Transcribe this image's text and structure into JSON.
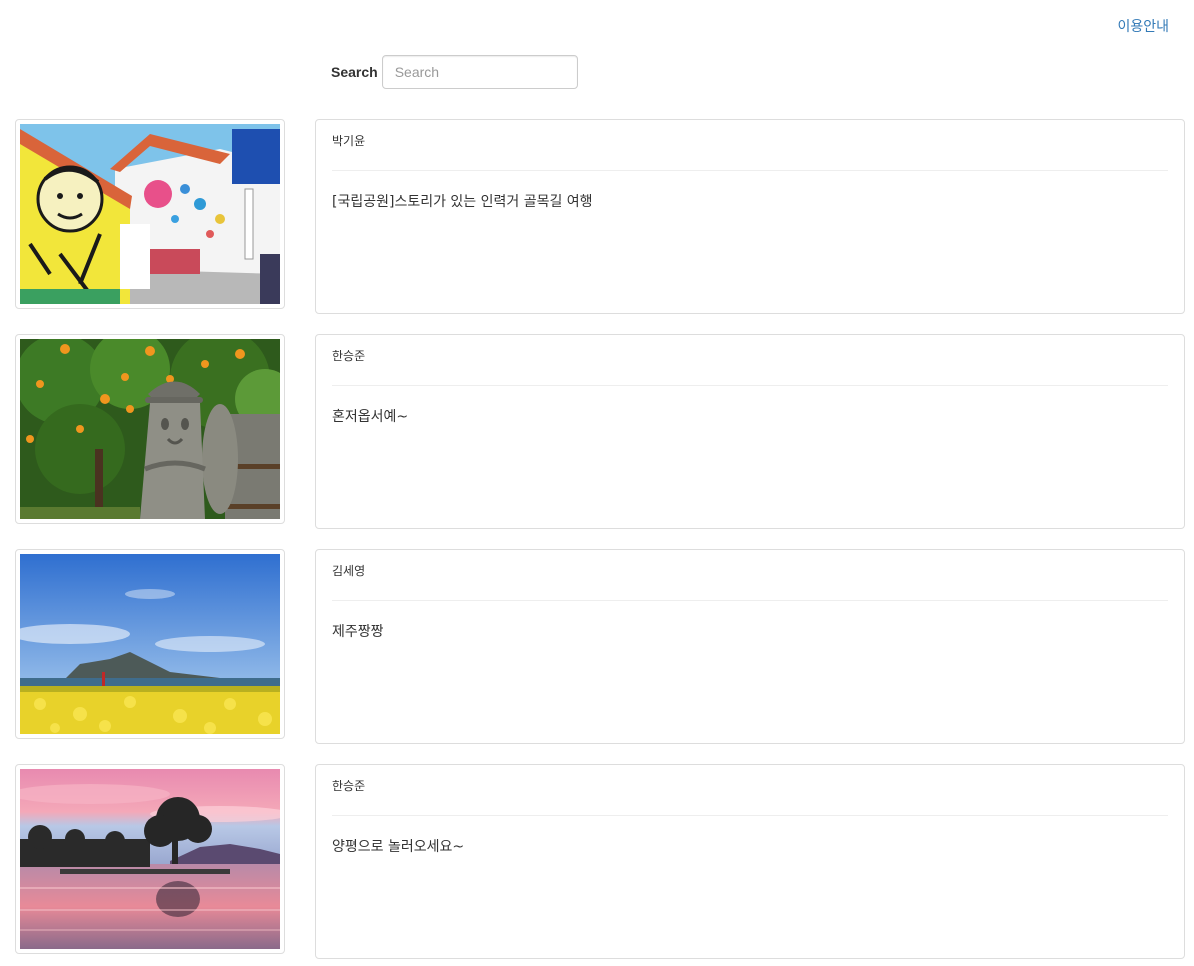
{
  "header": {
    "guide_link": "이용안내"
  },
  "search": {
    "label": "Search",
    "placeholder": "Search",
    "value": ""
  },
  "posts": [
    {
      "author": "박기윤",
      "title": "[국립공원]스토리가 있는 인력거 골목길 여행",
      "image": "mural-alley-photo"
    },
    {
      "author": "한승준",
      "title": "혼저옵서예~",
      "image": "dol-hareubang-tangerine-photo"
    },
    {
      "author": "김세영",
      "title": "제주짱짱",
      "image": "canola-field-seaside-photo"
    },
    {
      "author": "한승준",
      "title": "양평으로 놀러오세요~",
      "image": "lake-sunset-photo"
    }
  ]
}
